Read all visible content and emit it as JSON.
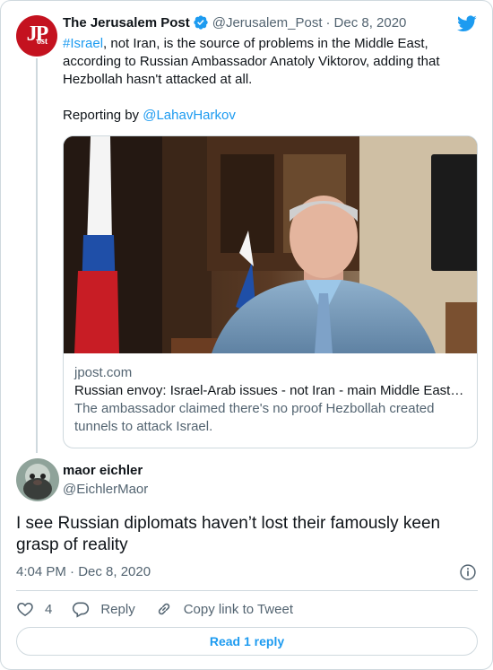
{
  "tweet": {
    "author_name": "The Jerusalem Post",
    "handle": "@Jerusalem_Post",
    "separator": "·",
    "date": "Dec 8, 2020",
    "hashtag": "#Israel",
    "text_after_hashtag": ", not Iran, is the source of problems in the Middle East, according to Russian Ambassador Anatoly Viktorov, adding that Hezbollah hasn't attacked at all.",
    "reporting_prefix": "Reporting by ",
    "reporting_mention": "@LahavHarkov",
    "avatar_text": "JPost",
    "verified": true
  },
  "link_card": {
    "domain": "jpost.com",
    "title": "Russian envoy: Israel-Arab issues - not Iran - main Middle East…",
    "description": "The ambassador claimed there's no proof Hezbollah created tunnels to attack Israel."
  },
  "reply": {
    "author_name": "maor eichler",
    "handle": "@EichlerMaor",
    "text": "I see Russian diplomats haven’t lost their famously keen grasp of reality",
    "timestamp": "4:04 PM · Dec 8, 2020"
  },
  "actions": {
    "like_count": "4",
    "reply_label": "Reply",
    "copy_link_label": "Copy link to Tweet"
  },
  "read_replies_label": "Read 1 reply",
  "colors": {
    "accent": "#1d9bf0",
    "muted": "#536471",
    "border": "#cfd9de",
    "jpost_red": "#c4121f"
  },
  "icons": [
    "verified-badge-icon",
    "twitter-bird-icon",
    "info-icon",
    "heart-icon",
    "reply-icon",
    "link-icon"
  ]
}
